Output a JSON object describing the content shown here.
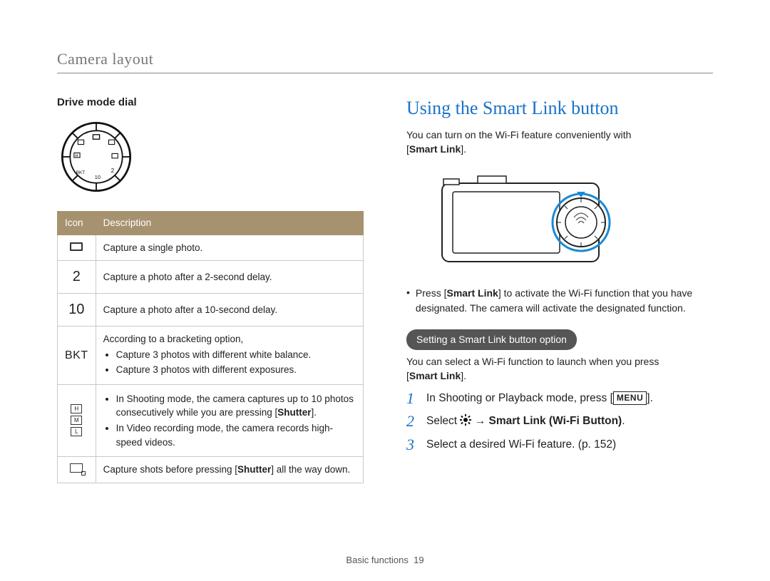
{
  "running_head": "Camera layout",
  "left": {
    "subhead": "Drive mode dial",
    "dial_labels": [
      "H",
      "M",
      "L",
      "BKT",
      "10",
      "2"
    ],
    "table": {
      "head_icon": "Icon",
      "head_desc": "Description",
      "rows": {
        "single": "Capture a single photo.",
        "delay2": "Capture a photo after a 2-second delay.",
        "delay10": "Capture a photo after a 10-second delay.",
        "bkt_intro": "According to a bracketing option,",
        "bkt_b1": "Capture 3 photos with different white balance.",
        "bkt_b2": "Capture 3 photos with different exposures.",
        "burst_b1a": "In Shooting mode, the camera captures up to 10 photos consecutively while you are pressing [",
        "burst_b1b": "].",
        "burst_b2": "In Video recording mode, the camera records high-speed videos.",
        "precap_a": "Capture shots before pressing [",
        "precap_b": "] all the way down.",
        "shutter": "Shutter"
      },
      "icons": {
        "num2": "2",
        "num10": "10",
        "bkt": "BKT",
        "burst_h": "H",
        "burst_m": "M",
        "burst_l": "L"
      }
    }
  },
  "right": {
    "title": "Using the Smart Link button",
    "intro_a": "You can turn on the Wi-Fi feature conveniently with ",
    "intro_b": ".",
    "smart_link_label": "Smart Link",
    "note_a": "Press [",
    "note_b": "] to activate the Wi-Fi function that you have designated. The camera will activate the designated function.",
    "pill": "Setting a Smart Link button option",
    "para2_a": "You can select a Wi-Fi function to launch when you press ",
    "para2_b": ".",
    "steps": {
      "s1a": "In Shooting or Playback mode, press [",
      "s1b": "].",
      "menu": "MENU",
      "s2a": "Select ",
      "s2b": " → ",
      "s2c": "Smart Link (Wi-Fi Button)",
      "s2d": ".",
      "s3": "Select a desired Wi-Fi feature. (p. 152)"
    }
  },
  "footer": {
    "section": "Basic functions",
    "page": "19"
  }
}
